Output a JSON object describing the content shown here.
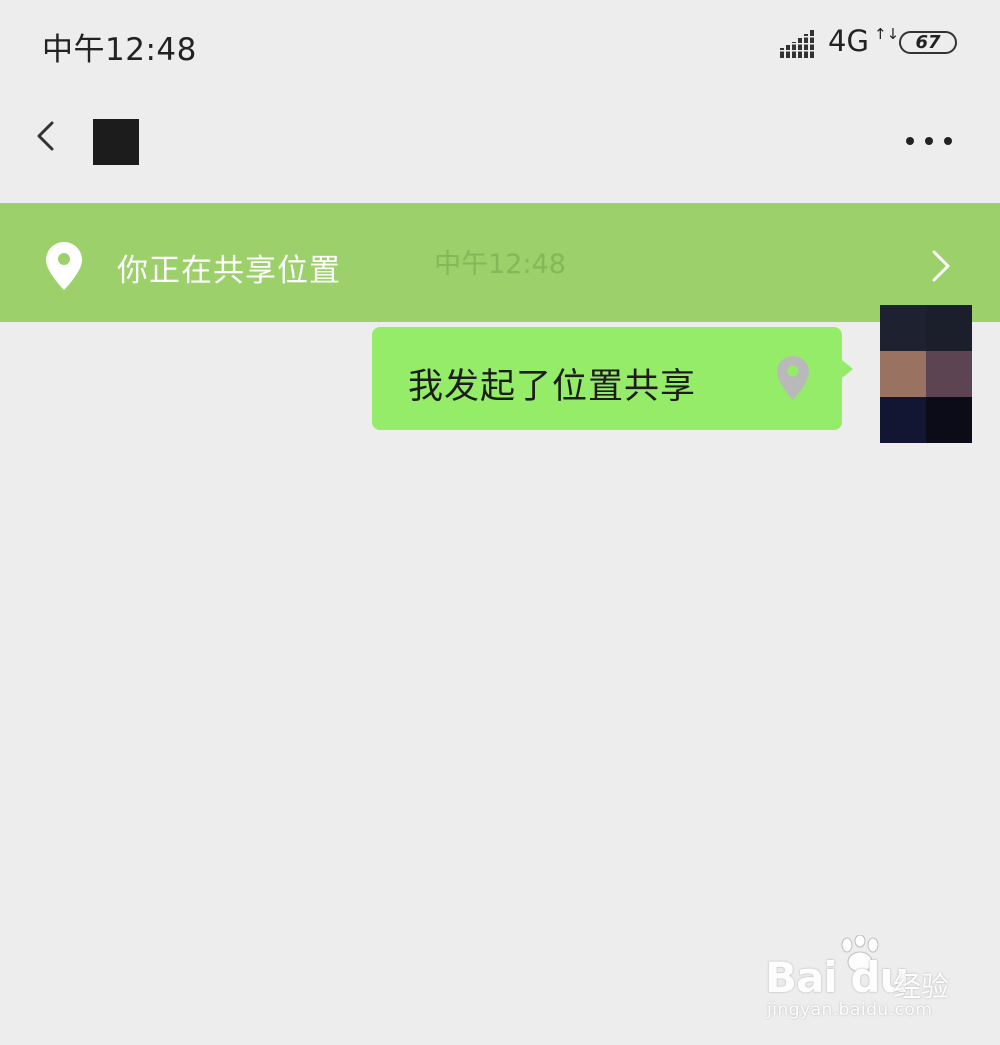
{
  "status_bar": {
    "time": "中午12:48",
    "network": "4G",
    "network_arrows": "↑↓",
    "battery": "67"
  },
  "nav_bar": {
    "back_icon": "back-chevron-icon",
    "more_icon": "more-dots-icon"
  },
  "share_banner": {
    "text": "你正在共享位置",
    "icon": "location-pin-icon",
    "background": "#9bd06a",
    "timestamp_ghost": "中午12:48"
  },
  "message": {
    "text": "我发起了位置共享",
    "icon": "location-pin-icon",
    "bubble_color": "#95ec69"
  },
  "watermark": {
    "logo_text": "Bai du",
    "logo_cn": "经验",
    "url": "jingyan.baidu.com"
  }
}
